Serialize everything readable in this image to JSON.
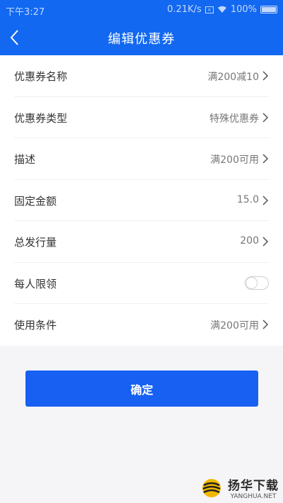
{
  "status_bar": {
    "time": "下午3:27",
    "network_speed": "0.21K/s",
    "battery": "100%"
  },
  "header": {
    "title": "编辑优惠券"
  },
  "form": {
    "rows": [
      {
        "label": "优惠券名称",
        "value": "满200减10"
      },
      {
        "label": "优惠券类型",
        "value": "特殊优惠券"
      },
      {
        "label": "描述",
        "value": "满200可用"
      },
      {
        "label": "固定金额",
        "value": "15.0"
      },
      {
        "label": "总发行量",
        "value": "200"
      },
      {
        "label": "每人限领",
        "toggle_on": false
      },
      {
        "label": "使用条件",
        "value": "满200可用"
      }
    ]
  },
  "confirm_label": "确定",
  "watermark": {
    "cn": "扬华下载",
    "en": "YANGHUA.NET"
  },
  "colors": {
    "primary": "#1268f0",
    "button": "#1760f2"
  }
}
